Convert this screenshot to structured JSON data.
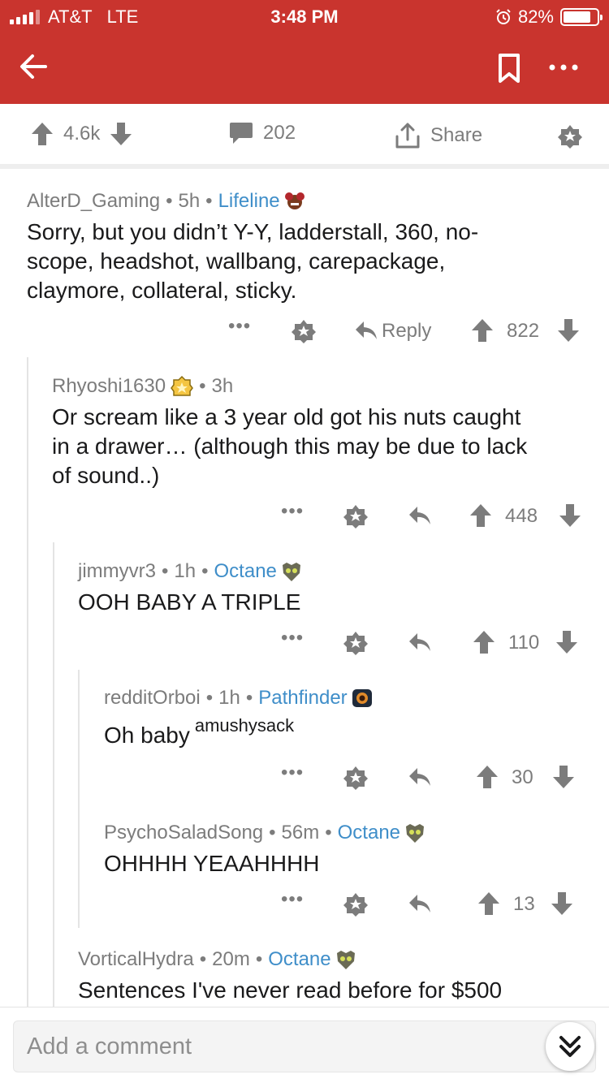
{
  "status_bar": {
    "carrier": "AT&T",
    "network": "LTE",
    "time": "3:48 PM",
    "battery": "82%",
    "battery_level": 0.82
  },
  "colors": {
    "header": "#c9342e",
    "flair": "#3f8ec9",
    "meta": "#7c7c7c"
  },
  "post_actions": {
    "score": "4.6k",
    "comments": "202",
    "share": "Share"
  },
  "comments": [
    {
      "author": "AlterD_Gaming",
      "age": "5h",
      "flair": "Lifeline",
      "flair_icon": "lifeline-icon",
      "lines": [
        "Sorry, but you didn’t Y-Y, ladderstall, 360, no-",
        "scope, headshot, wallbang, carepackage,",
        "claymore, collateral, sticky."
      ],
      "reply_label": "Reply",
      "score": "822"
    },
    {
      "author": "Rhyoshi1630",
      "age": "3h",
      "flair_icon": "badge-icon",
      "lines": [
        "Or scream like a 3 year old got his nuts caught",
        "in a drawer… (although this may be due to lack",
        "of sound..)"
      ],
      "score": "448"
    },
    {
      "author": "jimmyvr3",
      "age": "1h",
      "flair": "Octane",
      "flair_icon": "octane-icon",
      "lines": [
        "OOH BABY A TRIPLE"
      ],
      "score": "110"
    },
    {
      "author": "redditOrboi",
      "age": "1h",
      "flair": "Pathfinder",
      "flair_icon": "pathfinder-icon",
      "text": "Oh baby",
      "superscript": "amushysack",
      "score": "30"
    },
    {
      "author": "PsychoSaladSong",
      "age": "56m",
      "flair": "Octane",
      "flair_icon": "octane-icon",
      "lines": [
        "OHHHH YEAAHHHH"
      ],
      "score": "13"
    },
    {
      "author": "VorticalHydra",
      "age": "20m",
      "flair": "Octane",
      "flair_icon": "octane-icon",
      "lines": [
        "Sentences I've never read before for $500"
      ]
    }
  ],
  "composer": {
    "placeholder": "Add a comment"
  }
}
